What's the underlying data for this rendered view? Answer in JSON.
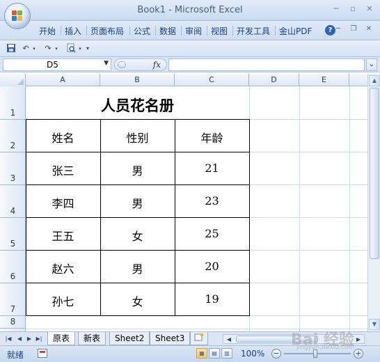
{
  "window": {
    "title": "Book1 - Microsoft Excel"
  },
  "ribbon": {
    "tabs": [
      "开始",
      "插入",
      "页面布局",
      "公式",
      "数据",
      "审阅",
      "视图",
      "开发工具",
      "金山PDF"
    ],
    "help": "?"
  },
  "formula_bar": {
    "name_box": "D5",
    "fx": "fx",
    "formula": ""
  },
  "columns": [
    "A",
    "B",
    "C",
    "D",
    "E"
  ],
  "rows": [
    "1",
    "2",
    "3",
    "4",
    "5",
    "6",
    "7",
    "8"
  ],
  "sheet": {
    "title": "人员花名册",
    "headers": [
      "姓名",
      "性别",
      "年龄"
    ],
    "records": [
      {
        "name": "张三",
        "gender": "男",
        "age": "21"
      },
      {
        "name": "李四",
        "gender": "男",
        "age": "23"
      },
      {
        "name": "王五",
        "gender": "女",
        "age": "25"
      },
      {
        "name": "赵六",
        "gender": "男",
        "age": "20"
      },
      {
        "name": "孙七",
        "gender": "女",
        "age": "19"
      }
    ]
  },
  "sheet_tabs": [
    "原表",
    "新表",
    "Sheet2",
    "Sheet3"
  ],
  "active_sheet": "原表",
  "status": {
    "ready": "就绪",
    "zoom": "100%"
  },
  "watermark": {
    "main": "Bai 经验",
    "sub": "jingyan.baidu.com"
  },
  "colors": {
    "accent": "#15428b",
    "ribbon_bg": "#cfdef2",
    "grid_line": "#d0d7e5"
  }
}
